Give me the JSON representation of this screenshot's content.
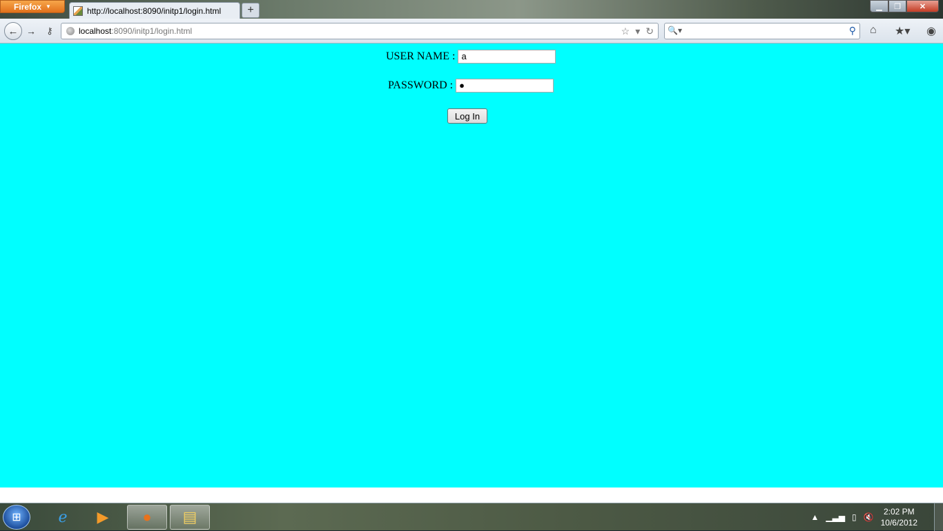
{
  "browser": {
    "menu_button": "Firefox",
    "tab_title": "http://localhost:8090/initp1/login.html",
    "newtab_label": "+",
    "url_host": "localhost",
    "url_rest": ":8090/initp1/login.html",
    "icons": {
      "back": "back-arrow-icon",
      "forward": "forward-arrow-icon",
      "identity": "key-icon",
      "bookmark": "star-icon",
      "reload": "reload-icon",
      "search_engine": "magnifier-icon",
      "home": "home-icon",
      "bookmarks_menu": "bookmarks-icon",
      "addon": "eye-icon"
    }
  },
  "window_controls": {
    "minimize": "minimize-icon",
    "maximize": "restore-icon",
    "close": "close-icon"
  },
  "page": {
    "background": "#00ffff",
    "username_label": "USER NAME :",
    "username_value": "a",
    "password_label": "PASSWORD :",
    "password_value": "●",
    "login_button": "Log In"
  },
  "taskbar": {
    "start": "windows-start-icon",
    "apps": [
      "internet-explorer-icon",
      "media-player-icon",
      "firefox-icon",
      "file-explorer-icon"
    ],
    "time": "2:02 PM",
    "date": "10/6/2012"
  }
}
